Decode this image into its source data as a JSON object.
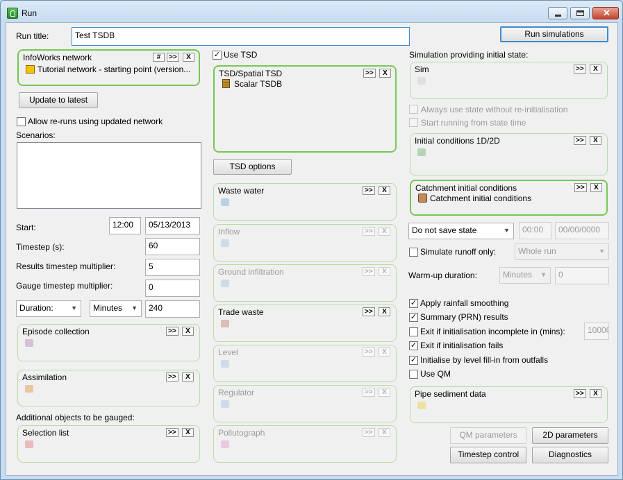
{
  "window": {
    "title": "Run"
  },
  "run_title": {
    "label": "Run title:",
    "value": "Test TSDB"
  },
  "run_simulations": "Run simulations",
  "infoworks": {
    "title": "InfoWorks network",
    "hash": "#",
    "expand": ">>",
    "clear": "X",
    "item": "Tutorial network - starting point (version..."
  },
  "update_latest": "Update to latest",
  "allow_reruns": {
    "label": "Allow re-runs using updated network",
    "checked": false
  },
  "scenarios": {
    "label": "Scenarios:"
  },
  "start": {
    "label": "Start:",
    "time": "12:00",
    "date": "05/13/2013"
  },
  "timestep": {
    "label": "Timestep (s):",
    "value": "60"
  },
  "results_mult": {
    "label": "Results timestep multiplier:",
    "value": "5"
  },
  "gauge_mult": {
    "label": "Gauge timestep multiplier:",
    "value": "0"
  },
  "duration": {
    "type": "Duration:",
    "unit": "Minutes",
    "value": "240"
  },
  "episode": {
    "title": "Episode collection"
  },
  "assimilation": {
    "title": "Assimilation"
  },
  "additional_label": "Additional objects to be gauged:",
  "selection_list": {
    "title": "Selection list"
  },
  "use_tsd": {
    "label": "Use TSD",
    "checked": true
  },
  "tsd_spatial": {
    "title": "TSD/Spatial TSD",
    "item": "Scalar TSDB"
  },
  "tsd_options": "TSD options",
  "waste_water": {
    "title": "Waste water"
  },
  "inflow": {
    "title": "Inflow"
  },
  "ground_infiltration": {
    "title": "Ground infiltration"
  },
  "trade_waste": {
    "title": "Trade waste"
  },
  "level": {
    "title": "Level"
  },
  "regulator": {
    "title": "Regulator"
  },
  "pollutograph": {
    "title": "Pollutograph"
  },
  "sim_initial_label": "Simulation providing initial state:",
  "sim": {
    "title": "Sim"
  },
  "always_use_state": {
    "label": "Always use state without re-initialisation",
    "checked": false
  },
  "start_running": {
    "label": "Start running from state time",
    "checked": false
  },
  "initial_conditions": {
    "title": "Initial conditions 1D/2D"
  },
  "catchment": {
    "title": "Catchment initial conditions",
    "item": "Catchment initial conditions"
  },
  "save_state": {
    "value": "Do not save state",
    "time": "00:00",
    "date": "00/00/0000"
  },
  "simulate_runoff": {
    "label": "Simulate runoff only:",
    "checked": false,
    "option": "Whole run"
  },
  "warmup": {
    "label": "Warm-up duration:",
    "unit": "Minutes",
    "value": "0"
  },
  "options": [
    {
      "label": "Apply rainfall smoothing",
      "checked": true
    },
    {
      "label": "Summary (PRN) results",
      "checked": true
    },
    {
      "label": "Exit if initialisation incomplete in (mins):",
      "checked": false
    },
    {
      "label": "Exit if initialisation fails",
      "checked": true
    },
    {
      "label": "Initialise by level fill-in from outfalls",
      "checked": true
    },
    {
      "label": "Use QM",
      "checked": false
    }
  ],
  "exit_incomplete_value": "10000",
  "pipe_sediment": {
    "title": "Pipe sediment data"
  },
  "buttons": {
    "qm": "QM parameters",
    "twod": "2D parameters",
    "timestep_control": "Timestep control",
    "diagnostics": "Diagnostics"
  },
  "common": {
    "expand": ">>",
    "clear": "X",
    "check": "✓"
  }
}
